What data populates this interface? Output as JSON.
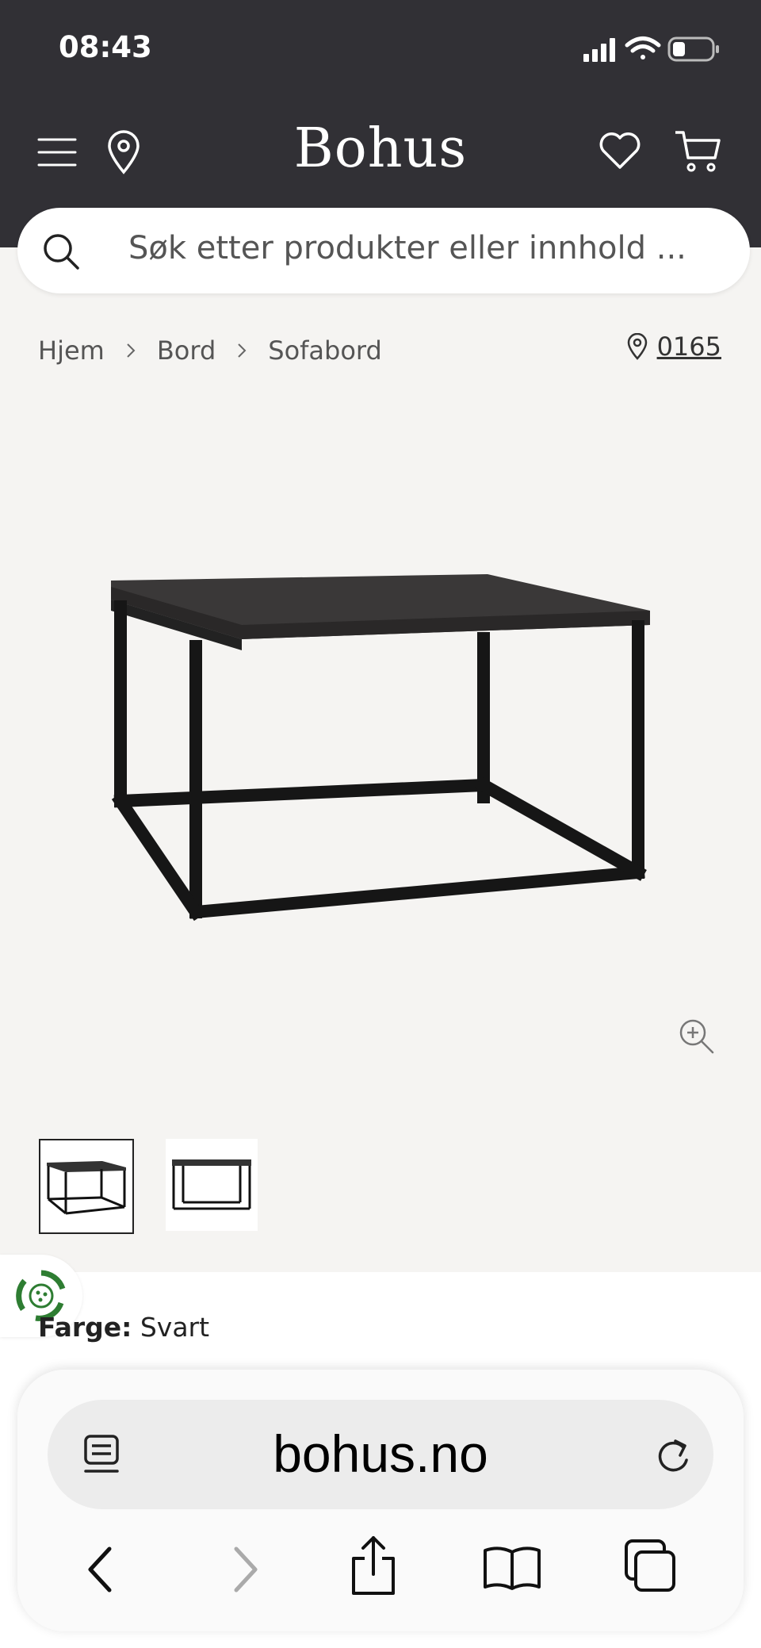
{
  "status_bar": {
    "time": "08:43"
  },
  "header": {
    "logo": "Bohus"
  },
  "search": {
    "placeholder": "Søk etter produkter eller innhold ..."
  },
  "breadcrumbs": [
    {
      "label": "Hjem"
    },
    {
      "label": "Bord"
    },
    {
      "label": "Sofabord"
    }
  ],
  "store": {
    "code": "0165"
  },
  "product": {
    "color_label": "Farge:",
    "color_value": "Svart"
  },
  "browser": {
    "url": "bohus.no"
  },
  "colors": {
    "header_bg": "#313035",
    "page_bg": "#f5f4f2",
    "eco_green": "#2e7d32"
  }
}
